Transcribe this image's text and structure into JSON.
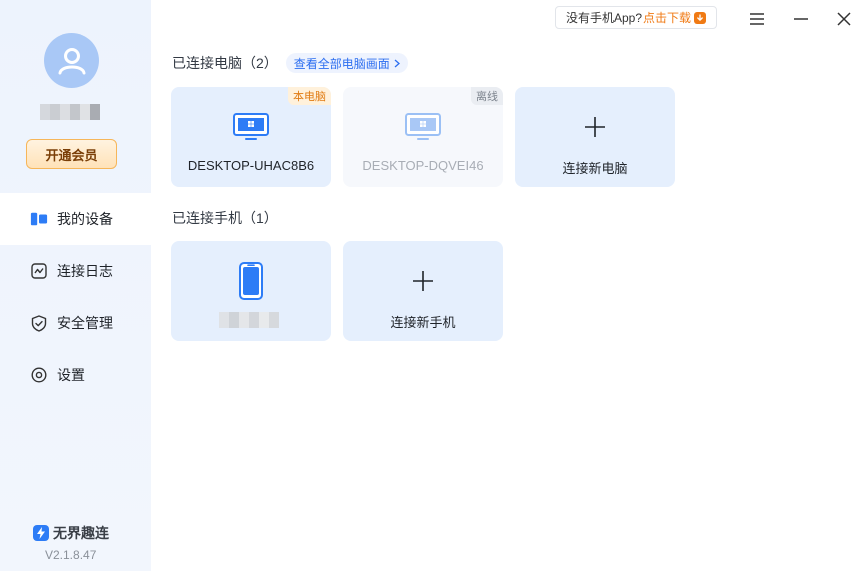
{
  "app": {
    "name": "无界趣连",
    "version": "V2.1.8.47"
  },
  "sidebar": {
    "vip_label": "开通会员",
    "items": [
      {
        "label": "我的设备",
        "icon": "devices-icon",
        "active": true
      },
      {
        "label": "连接日志",
        "icon": "log-chart-icon",
        "active": false
      },
      {
        "label": "安全管理",
        "icon": "shield-check-icon",
        "active": false
      },
      {
        "label": "设置",
        "icon": "settings-icon",
        "active": false
      }
    ]
  },
  "topbar": {
    "banner_text": "没有手机App?",
    "banner_link": "点击下载"
  },
  "computers": {
    "title": "已连接电脑（2）",
    "view_all": "查看全部电脑画面",
    "cards": [
      {
        "name": "DESKTOP-UHAC8B6",
        "tag": "本电脑",
        "status": "online"
      },
      {
        "name": "DESKTOP-DQVEI46",
        "tag": "离线",
        "status": "offline"
      },
      {
        "name": "连接新电脑",
        "type": "add"
      }
    ]
  },
  "phones": {
    "title": "已连接手机（1）",
    "cards": [
      {
        "name": "",
        "type": "phone"
      },
      {
        "name": "连接新手机",
        "type": "add"
      }
    ]
  },
  "colors": {
    "accent": "#2d7cf6",
    "orange": "#f07a14",
    "card_bg": "#e5effd"
  }
}
